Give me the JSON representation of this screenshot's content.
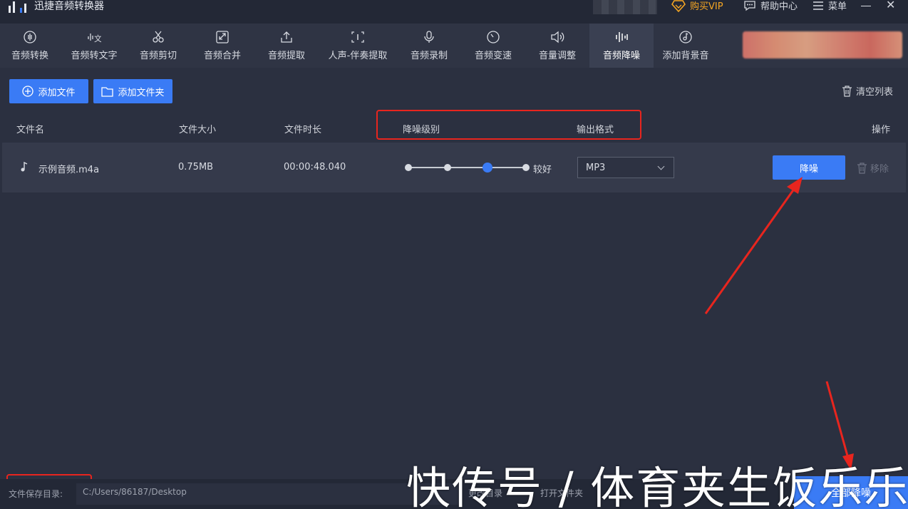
{
  "app": {
    "title": "迅捷音频转换器"
  },
  "titlebar": {
    "vip": "购买VIP",
    "help": "帮助中心",
    "menu": "菜单"
  },
  "toolbar": {
    "items": [
      {
        "label": "音频转换",
        "icon": "waveform-icon"
      },
      {
        "label": "音频转文字",
        "icon": "speech-to-text-icon"
      },
      {
        "label": "音频剪切",
        "icon": "scissors-icon"
      },
      {
        "label": "音频合并",
        "icon": "merge-icon"
      },
      {
        "label": "音频提取",
        "icon": "upload-icon"
      },
      {
        "label": "人声-伴奏提取",
        "icon": "vocal-separate-icon"
      },
      {
        "label": "音频录制",
        "icon": "microphone-icon"
      },
      {
        "label": "音频变速",
        "icon": "speedometer-icon"
      },
      {
        "label": "音量调整",
        "icon": "volume-icon"
      },
      {
        "label": "音频降噪",
        "icon": "denoise-icon",
        "active": true
      },
      {
        "label": "添加背景音",
        "icon": "music-note-icon"
      }
    ]
  },
  "actions": {
    "add_file": "添加文件",
    "add_folder": "添加文件夹",
    "clear_list": "清空列表"
  },
  "table": {
    "headers": {
      "name": "文件名",
      "size": "文件大小",
      "duration": "文件时长",
      "level": "降噪级别",
      "format": "输出格式",
      "ops": "操作"
    },
    "rows": [
      {
        "name": "示例音频.m4a",
        "size": "0.75MB",
        "duration": "00:00:48.040",
        "level_label": "较好",
        "level_step": 3,
        "level_steps": 4,
        "format": "MP3",
        "denoise": "降噪",
        "remove": "移除"
      }
    ]
  },
  "footer": {
    "save_label": "文件保存目录:",
    "save_path": "C:/Users/86187/Desktop",
    "change_dir": "更改目录",
    "open_folder": "打开文件夹",
    "convert_all": "全部降噪"
  },
  "watermark": "快传号 / 体育夹生饭乐乐",
  "colors": {
    "accent": "#3a7bf5",
    "highlight": "#e8251e",
    "vip": "#f5a623"
  }
}
